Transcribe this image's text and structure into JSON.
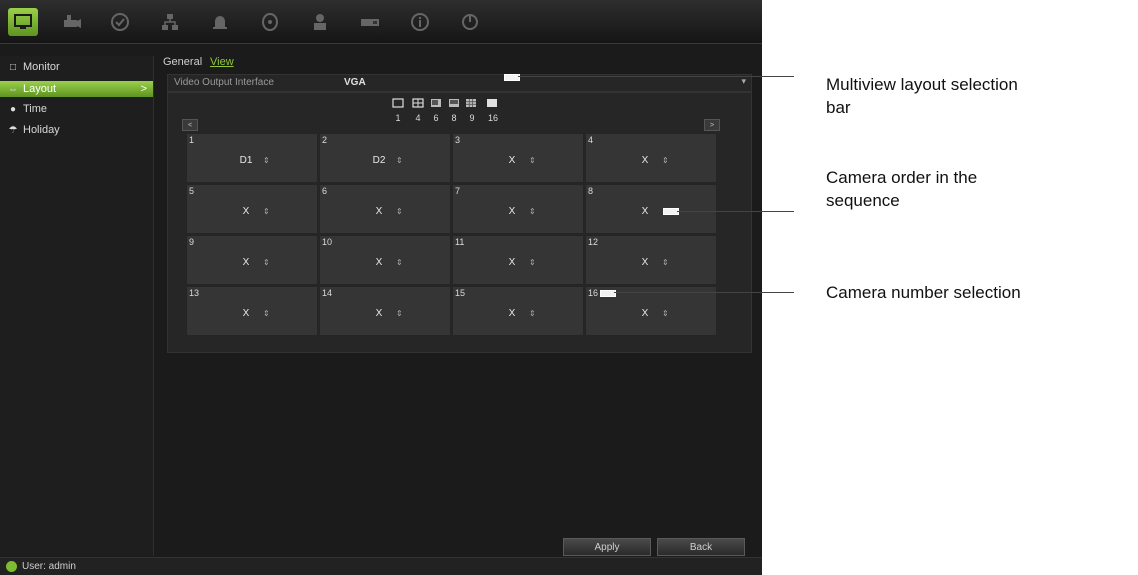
{
  "topbar": {
    "icons": [
      "monitor-icon",
      "camera-icon",
      "record-icon",
      "network-icon",
      "alarm-icon",
      "hdd-icon",
      "user-icon",
      "device-icon",
      "info-icon",
      "power-icon"
    ]
  },
  "sidebar": {
    "items": [
      {
        "label": "Monitor",
        "icon": "monitor-small-icon"
      },
      {
        "label": "Layout",
        "icon": "layout-icon",
        "arrow": ">"
      },
      {
        "label": "Time",
        "icon": "clock-icon"
      },
      {
        "label": "Holiday",
        "icon": "holiday-icon"
      }
    ]
  },
  "tabs": [
    {
      "label": "General"
    },
    {
      "label": "View"
    }
  ],
  "video_output": {
    "label": "Video Output Interface",
    "value": "VGA"
  },
  "layout_bar": {
    "numbers": [
      "1",
      "4",
      "6",
      "8",
      "9",
      "16"
    ],
    "prev": "<",
    "next": ">"
  },
  "grid": [
    {
      "idx": "1",
      "val": "D1"
    },
    {
      "idx": "2",
      "val": "D2"
    },
    {
      "idx": "3",
      "val": "X"
    },
    {
      "idx": "4",
      "val": "X"
    },
    {
      "idx": "5",
      "val": "X"
    },
    {
      "idx": "6",
      "val": "X"
    },
    {
      "idx": "7",
      "val": "X"
    },
    {
      "idx": "8",
      "val": "X"
    },
    {
      "idx": "9",
      "val": "X"
    },
    {
      "idx": "10",
      "val": "X"
    },
    {
      "idx": "11",
      "val": "X"
    },
    {
      "idx": "12",
      "val": "X"
    },
    {
      "idx": "13",
      "val": "X"
    },
    {
      "idx": "14",
      "val": "X"
    },
    {
      "idx": "15",
      "val": "X"
    },
    {
      "idx": "16",
      "val": "X"
    }
  ],
  "buttons": {
    "apply": "Apply",
    "back": "Back"
  },
  "status": {
    "user": "User: admin"
  },
  "callouts": [
    {
      "line1": "Multiview layout selection",
      "line2": "bar"
    },
    {
      "line1": "Camera order in the",
      "line2": "sequence"
    },
    {
      "line1": "Camera number selection",
      "line2": ""
    }
  ],
  "colors": {
    "accent": "#8fc63c",
    "background": "#1b1b1b"
  }
}
